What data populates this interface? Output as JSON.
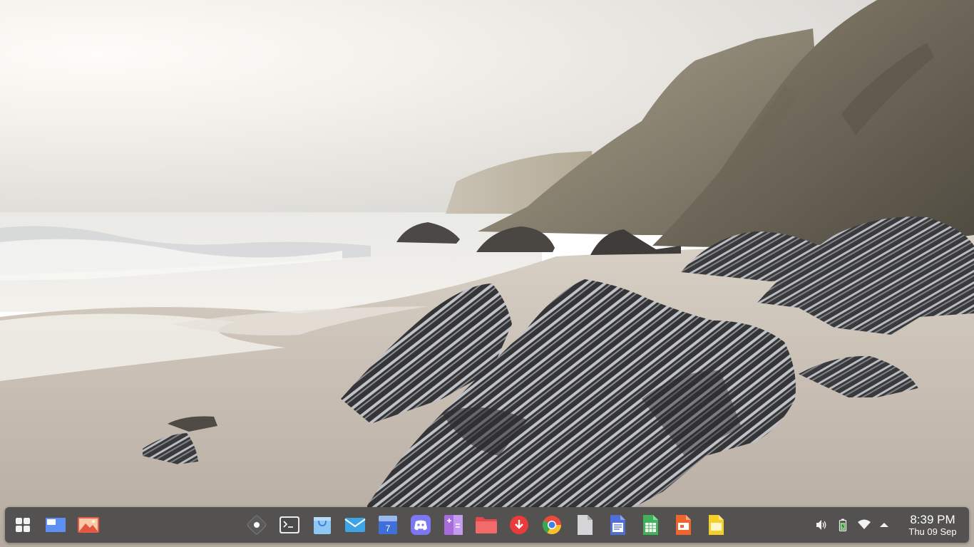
{
  "taskbar": {
    "left": [
      {
        "name": "app-grid-button",
        "icon": "app-grid-icon"
      },
      {
        "name": "workspace-switcher-button",
        "icon": "workspace-icon"
      },
      {
        "name": "image-viewer-button",
        "icon": "image-viewer-icon"
      }
    ],
    "dock": [
      {
        "name": "budgie-menu-button",
        "icon": "settings-diamond-icon"
      },
      {
        "name": "terminal-button",
        "icon": "terminal-icon"
      },
      {
        "name": "software-center-button",
        "icon": "store-bag-icon"
      },
      {
        "name": "mail-button",
        "icon": "mail-icon"
      },
      {
        "name": "calendar-button",
        "icon": "calendar-icon",
        "calendar_day": "7"
      },
      {
        "name": "discord-button",
        "icon": "discord-icon"
      },
      {
        "name": "calculator-button",
        "icon": "calculator-icon"
      },
      {
        "name": "files-button",
        "icon": "folder-icon"
      },
      {
        "name": "downloader-button",
        "icon": "download-icon"
      },
      {
        "name": "chrome-button",
        "icon": "chrome-icon"
      },
      {
        "name": "document-button",
        "icon": "document-icon"
      },
      {
        "name": "writer-button",
        "icon": "writer-icon"
      },
      {
        "name": "spreadsheet-button",
        "icon": "spreadsheet-icon"
      },
      {
        "name": "presentation-button",
        "icon": "presentation-icon"
      },
      {
        "name": "notes-button",
        "icon": "notes-icon"
      }
    ],
    "tray": [
      {
        "name": "volume-button",
        "icon": "volume-icon"
      },
      {
        "name": "battery-button",
        "icon": "battery-charging-icon"
      },
      {
        "name": "wifi-button",
        "icon": "wifi-icon"
      },
      {
        "name": "tray-expand-button",
        "icon": "chevron-up-icon"
      }
    ],
    "clock": {
      "time": "8:39 PM",
      "date": "Thu 09 Sep"
    }
  }
}
